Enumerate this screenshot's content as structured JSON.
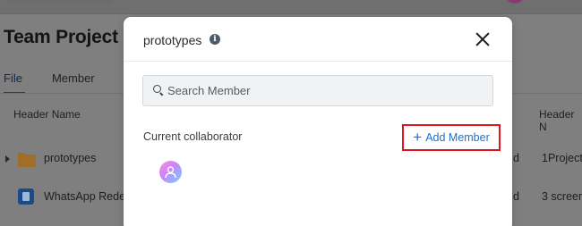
{
  "background": {
    "page_title": "Team Project",
    "tabs": [
      {
        "label": "File",
        "active": true
      },
      {
        "label": "Member",
        "active": false
      }
    ],
    "columns": {
      "name_header": "Header Name",
      "right_header": "Header N"
    },
    "rows": [
      {
        "name": "prototypes",
        "icon": "folder-icon",
        "cell_d": "d",
        "cell_r": "1Project"
      },
      {
        "name": "WhatsApp Rede",
        "icon": "app-icon",
        "cell_d": "d",
        "cell_r": "3 screen"
      }
    ]
  },
  "modal": {
    "title": "prototypes",
    "info_icon_glyph": "i",
    "search": {
      "placeholder": "Search Member",
      "value": ""
    },
    "collaborator_label": "Current collaborator",
    "add_member": {
      "plus": "+",
      "label": "Add Member"
    }
  },
  "colors": {
    "accent": "#1f6fd0",
    "highlight_border": "#e0161e",
    "overlay": "#7f7f7f",
    "folder": "#b07a2e"
  }
}
